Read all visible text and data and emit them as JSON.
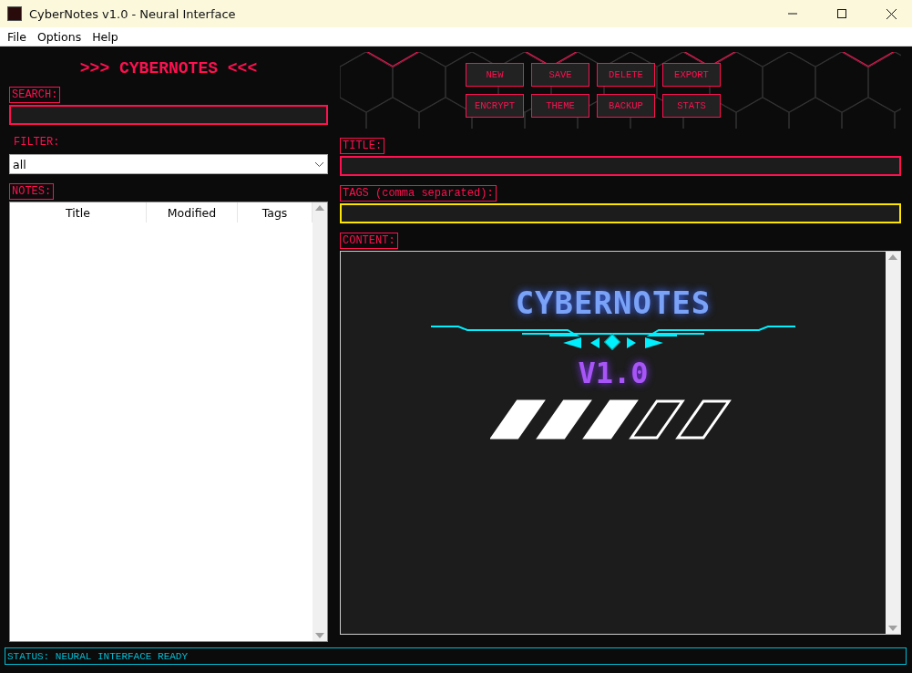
{
  "window": {
    "title": "CyberNotes v1.0 - Neural Interface"
  },
  "menu": [
    "File",
    "Options",
    "Help"
  ],
  "sidebar": {
    "heading": ">>> CYBERNOTES <<<",
    "search": {
      "label": "SEARCH:"
    },
    "filter": {
      "label": "FILTER:",
      "value": "all"
    },
    "notes": {
      "label": "NOTES:",
      "columns": [
        "Title",
        "Modified",
        "Tags"
      ]
    }
  },
  "toolbar": {
    "buttons": [
      [
        "NEW",
        "SAVE",
        "DELETE",
        "EXPORT"
      ],
      [
        "ENCRYPT",
        "THEME",
        "BACKUP",
        "STATS"
      ]
    ]
  },
  "editor": {
    "title_label": "TITLE:",
    "tags_label": "TAGS (comma separated):",
    "content_label": "CONTENT:"
  },
  "splash": {
    "logo": "CYBERNOTES",
    "version": "V1.0",
    "level": 0.6
  },
  "status_bar": "STATUS: NEURAL INTERFACE READY"
}
